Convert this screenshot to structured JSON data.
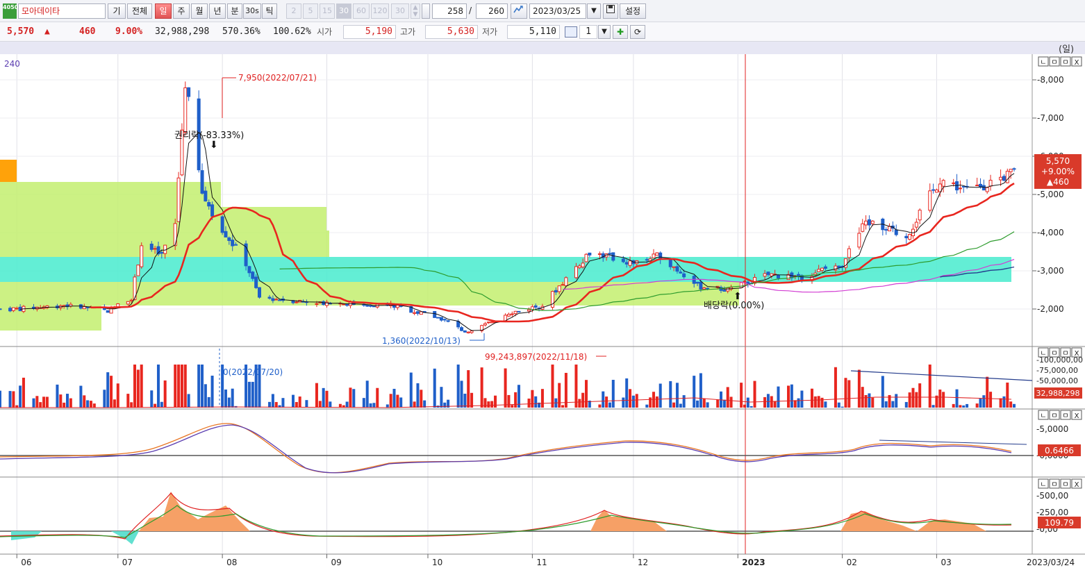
{
  "toolbar": {
    "symbol_badge": "4050",
    "stock_name": "모아데이타",
    "btn_gi": "기",
    "btn_all": "전체",
    "btn_day": "일",
    "btn_week": "주",
    "btn_month": "월",
    "btn_year": "년",
    "btn_min": "분",
    "btn_30s": "30s",
    "btn_tick": "틱",
    "periods": [
      "2",
      "5",
      "15",
      "30",
      "60",
      "120",
      "30"
    ],
    "count_current": "258",
    "count_sep": "/",
    "count_total": "260",
    "date": "2023/03/25",
    "btn_settings": "설정"
  },
  "quote": {
    "price": "5,570",
    "arrow": "▲",
    "change": "460",
    "change_pct": "9.00%",
    "volume": "32,988,298",
    "vol_ratio": "570.36%",
    "strength": "100.62%",
    "open_label": "시가",
    "open": "5,190",
    "high_label": "고가",
    "high": "5,630",
    "low_label": "저가",
    "low": "5,110",
    "qty": "1"
  },
  "chart": {
    "unit_label": "(일)",
    "period_label": "240",
    "annot_high": "7,950(2022/07/21)",
    "annot_rights": "권리락(-83.33%)",
    "annot_low": "1,360(2022/10/13)",
    "annot_dividend": "배당락(0.00%)",
    "annot_maxvol": "99,243,897(2022/11/18)",
    "annot_minvol": "0(2022/07/20)",
    "last_price": "5,570",
    "last_pct": "+9.00%",
    "last_change": "▲460",
    "last_volume": "32,988,298",
    "last_macd": "0.6466",
    "last_osc": "109.79",
    "bottom_date": "2023/03/24",
    "panel_buttons": [
      "ㄴ",
      "ㅁ",
      "ㅁ",
      "X"
    ]
  },
  "chart_data": {
    "type": "candlestick",
    "title": "모아데이타",
    "x_months": [
      "06",
      "07",
      "08",
      "09",
      "10",
      "11",
      "12",
      "2023",
      "02",
      "03"
    ],
    "price_axis": {
      "ticks": [
        "8,000",
        "7,000",
        "6,000",
        "5,000",
        "4,000",
        "3,000",
        "2,000"
      ],
      "range": [
        1300,
        8300
      ]
    },
    "volume_axis": {
      "ticks": [
        "100,000,00",
        "75,000,00",
        "50,000,00"
      ]
    },
    "macd_axis": {
      "ticks": [
        "5,0000",
        "0,0000"
      ]
    },
    "osc_axis": {
      "ticks": [
        "500,00",
        "250,00",
        "0,00"
      ]
    },
    "close_series": [
      [
        "2022-06-01",
        2000
      ],
      [
        "2022-06-15",
        2100
      ],
      [
        "2022-06-28",
        1950
      ],
      [
        "2022-07-05",
        2300
      ],
      [
        "2022-07-08",
        3700
      ],
      [
        "2022-07-14",
        3400
      ],
      [
        "2022-07-18",
        4200
      ],
      [
        "2022-07-21",
        7950
      ],
      [
        "2022-07-26",
        5000
      ],
      [
        "2022-08-01",
        4100
      ],
      [
        "2022-08-08",
        3200
      ],
      [
        "2022-08-12",
        2300
      ],
      [
        "2022-08-25",
        2200
      ],
      [
        "2022-09-05",
        2150
      ],
      [
        "2022-09-20",
        2100
      ],
      [
        "2022-10-05",
        1750
      ],
      [
        "2022-10-13",
        1360
      ],
      [
        "2022-10-25",
        1900
      ],
      [
        "2022-11-04",
        2100
      ],
      [
        "2022-11-18",
        3500
      ],
      [
        "2022-12-01",
        3200
      ],
      [
        "2022-12-09",
        3400
      ],
      [
        "2022-12-20",
        2600
      ],
      [
        "2022-12-29",
        2500
      ],
      [
        "2023-01-10",
        2900
      ],
      [
        "2023-01-20",
        2850
      ],
      [
        "2023-02-01",
        3200
      ],
      [
        "2023-02-08",
        4300
      ],
      [
        "2023-02-20",
        3900
      ],
      [
        "2023-03-02",
        5400
      ],
      [
        "2023-03-10",
        5100
      ],
      [
        "2023-03-24",
        5570
      ]
    ]
  },
  "colors": {
    "up": "#e8261f",
    "down": "#1f5fc9",
    "ma_red": "#e8261f",
    "ma_green": "#2e9c2e",
    "ma_pink": "#d23cd2",
    "ma_navy": "#243c8c",
    "zone_green": "#c3ef6e",
    "zone_cyan": "#52ecd0"
  }
}
